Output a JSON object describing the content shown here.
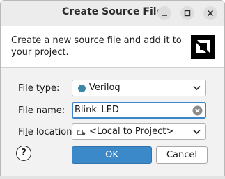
{
  "window": {
    "title": "Create Source File"
  },
  "banner": {
    "description": "Create a new source file and add it to your project.",
    "logo_icon": "amd-logo-icon"
  },
  "form": {
    "file_type": {
      "label_prefix": "",
      "label_mnemonic": "F",
      "label_rest": "ile type:",
      "value": "Verilog",
      "icon": "verilog-dot-icon",
      "icon_color": "#3d88a8"
    },
    "file_name": {
      "label_prefix": "F",
      "label_mnemonic": "i",
      "label_rest": "le name:",
      "value": "Blink_LED"
    },
    "file_location": {
      "label_prefix": "Fi",
      "label_mnemonic": "l",
      "label_rest": "e location:",
      "value": "<Local to Project>",
      "icon": "folder-link-icon"
    }
  },
  "buttons": {
    "help": "?",
    "ok": "OK",
    "cancel": "Cancel"
  },
  "colors": {
    "accent": "#3b89c9",
    "focus": "#3a86c8"
  }
}
